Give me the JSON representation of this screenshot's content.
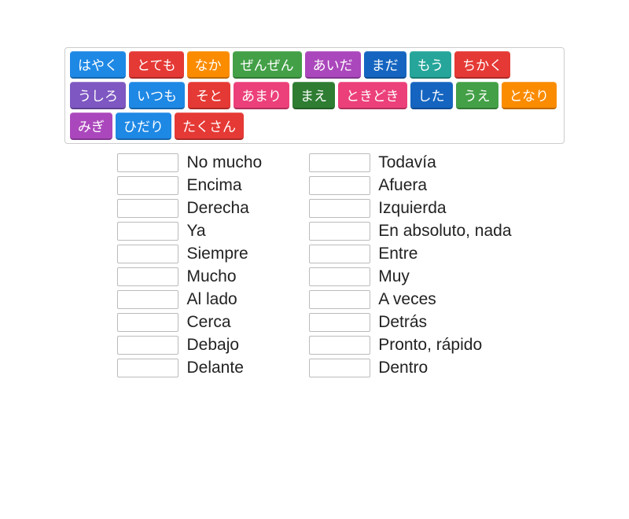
{
  "tiles": [
    {
      "text": "はやく",
      "bg": "#1e88e5"
    },
    {
      "text": "とても",
      "bg": "#e53935"
    },
    {
      "text": "なか",
      "bg": "#fb8c00"
    },
    {
      "text": "ぜんぜん",
      "bg": "#43a047"
    },
    {
      "text": "あいだ",
      "bg": "#ab47bc"
    },
    {
      "text": "まだ",
      "bg": "#1565c0"
    },
    {
      "text": "もう",
      "bg": "#26a69a"
    },
    {
      "text": "ちかく",
      "bg": "#e53935"
    },
    {
      "text": "うしろ",
      "bg": "#7e57c2"
    },
    {
      "text": "いつも",
      "bg": "#1e88e5"
    },
    {
      "text": "そと",
      "bg": "#e53935"
    },
    {
      "text": "あまり",
      "bg": "#ec407a"
    },
    {
      "text": "まえ",
      "bg": "#2e7d32"
    },
    {
      "text": "ときどき",
      "bg": "#ec407a"
    },
    {
      "text": "した",
      "bg": "#1565c0"
    },
    {
      "text": "うえ",
      "bg": "#43a047"
    },
    {
      "text": "となり",
      "bg": "#fb8c00"
    },
    {
      "text": "みぎ",
      "bg": "#ab47bc"
    },
    {
      "text": "ひだり",
      "bg": "#1e88e5"
    },
    {
      "text": "たくさん",
      "bg": "#e53935"
    }
  ],
  "left_column": [
    "No mucho",
    "Encima",
    "Derecha",
    "Ya",
    "Siempre",
    "Mucho",
    "Al lado",
    "Cerca",
    "Debajo",
    "Delante"
  ],
  "right_column": [
    "Todavía",
    "Afuera",
    "Izquierda",
    "En absoluto, nada",
    "Entre",
    "Muy",
    "A veces",
    "Detrás",
    "Pronto, rápido",
    "Dentro"
  ]
}
